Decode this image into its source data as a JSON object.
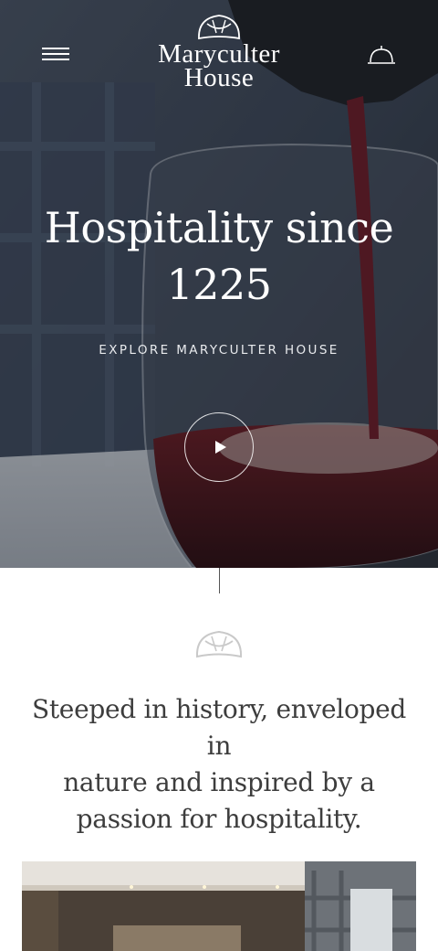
{
  "header": {
    "logo_line1": "Maryculter",
    "logo_line2": "House",
    "menu_icon": "hamburger-icon",
    "reserve_icon": "service-bell-icon"
  },
  "hero": {
    "title_line1": "Hospitality since",
    "title_line2": "1225",
    "explore_link": "EXPLORE MARYCULTER HOUSE",
    "play_icon": "play-icon",
    "image": "wine-glass-photo"
  },
  "intro": {
    "line1": "Steeped in history, enveloped in",
    "line2": "nature and inspired by a",
    "line3": "passion for hospitality."
  },
  "colors": {
    "text_dark": "#3d3d3d",
    "white": "#ffffff",
    "hero_overlay": "#2b3340"
  }
}
